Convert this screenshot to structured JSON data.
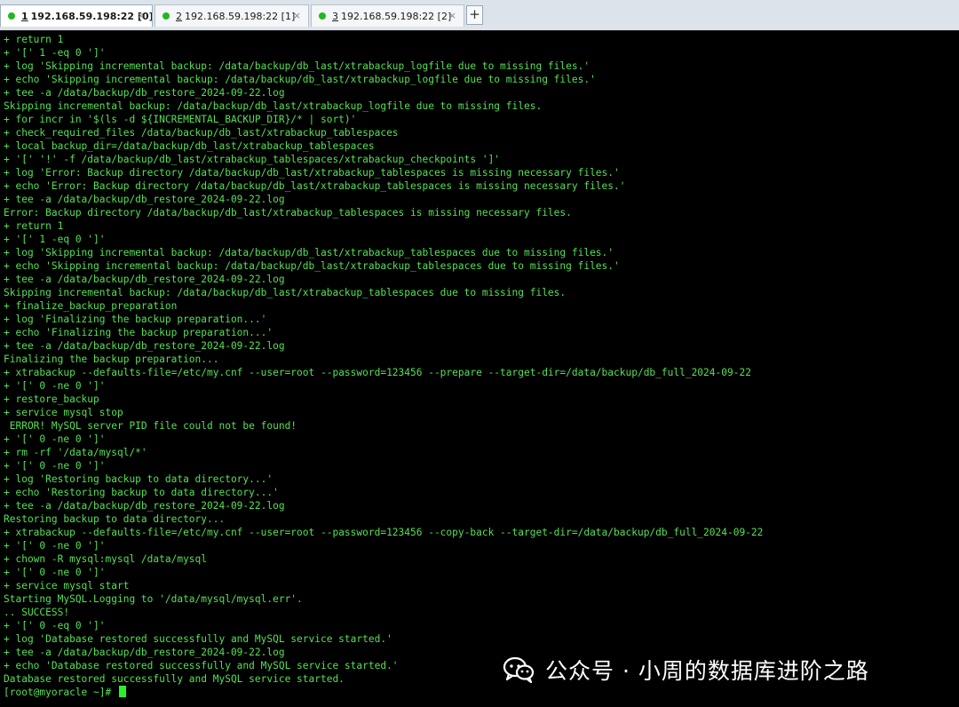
{
  "tabs": [
    {
      "num": "1",
      "title": "192.168.59.198:22 [0]",
      "close": "×",
      "active": true
    },
    {
      "num": "2",
      "title": "192.168.59.198:22 [1]",
      "close": "×",
      "active": false
    },
    {
      "num": "3",
      "title": "192.168.59.198:22 [2]",
      "close": "×",
      "active": false
    }
  ],
  "new_tab_label": "+",
  "terminal": {
    "lines": [
      "+ return 1",
      "+ '[' 1 -eq 0 ']'",
      "+ log 'Skipping incremental backup: /data/backup/db_last/xtrabackup_logfile due to missing files.'",
      "+ echo 'Skipping incremental backup: /data/backup/db_last/xtrabackup_logfile due to missing files.'",
      "+ tee -a /data/backup/db_restore_2024-09-22.log",
      "Skipping incremental backup: /data/backup/db_last/xtrabackup_logfile due to missing files.",
      "+ for incr in '$(ls -d ${INCREMENTAL_BACKUP_DIR}/* | sort)'",
      "+ check_required_files /data/backup/db_last/xtrabackup_tablespaces",
      "+ local backup_dir=/data/backup/db_last/xtrabackup_tablespaces",
      "+ '[' '!' -f /data/backup/db_last/xtrabackup_tablespaces/xtrabackup_checkpoints ']'",
      "+ log 'Error: Backup directory /data/backup/db_last/xtrabackup_tablespaces is missing necessary files.'",
      "+ echo 'Error: Backup directory /data/backup/db_last/xtrabackup_tablespaces is missing necessary files.'",
      "+ tee -a /data/backup/db_restore_2024-09-22.log",
      "Error: Backup directory /data/backup/db_last/xtrabackup_tablespaces is missing necessary files.",
      "+ return 1",
      "+ '[' 1 -eq 0 ']'",
      "+ log 'Skipping incremental backup: /data/backup/db_last/xtrabackup_tablespaces due to missing files.'",
      "+ echo 'Skipping incremental backup: /data/backup/db_last/xtrabackup_tablespaces due to missing files.'",
      "+ tee -a /data/backup/db_restore_2024-09-22.log",
      "Skipping incremental backup: /data/backup/db_last/xtrabackup_tablespaces due to missing files.",
      "+ finalize_backup_preparation",
      "+ log 'Finalizing the backup preparation...'",
      "+ echo 'Finalizing the backup preparation...'",
      "+ tee -a /data/backup/db_restore_2024-09-22.log",
      "Finalizing the backup preparation...",
      "+ xtrabackup --defaults-file=/etc/my.cnf --user=root --password=123456 --prepare --target-dir=/data/backup/db_full_2024-09-22",
      "+ '[' 0 -ne 0 ']'",
      "+ restore_backup",
      "+ service mysql stop",
      " ERROR! MySQL server PID file could not be found!",
      "+ '[' 0 -ne 0 ']'",
      "+ rm -rf '/data/mysql/*'",
      "+ '[' 0 -ne 0 ']'",
      "+ log 'Restoring backup to data directory...'",
      "+ echo 'Restoring backup to data directory...'",
      "+ tee -a /data/backup/db_restore_2024-09-22.log",
      "Restoring backup to data directory...",
      "+ xtrabackup --defaults-file=/etc/my.cnf --user=root --password=123456 --copy-back --target-dir=/data/backup/db_full_2024-09-22",
      "+ '[' 0 -ne 0 ']'",
      "+ chown -R mysql:mysql /data/mysql",
      "+ '[' 0 -ne 0 ']'",
      "+ service mysql start",
      "Starting MySQL.Logging to '/data/mysql/mysql.err'.",
      ".. SUCCESS!",
      "+ '[' 0 -eq 0 ']'",
      "+ log 'Database restored successfully and MySQL service started.'",
      "+ tee -a /data/backup/db_restore_2024-09-22.log",
      "+ echo 'Database restored successfully and MySQL service started.'",
      "Database restored successfully and MySQL service started."
    ],
    "prompt": "[root@myoracle ~]# "
  },
  "watermark": {
    "text": "公众号 · 小周的数据库进阶之路",
    "icon": "wechat-icon"
  },
  "colors": {
    "terminal_bg": "#000000",
    "terminal_text": "#55e055",
    "tab_dot": "#22b722"
  }
}
